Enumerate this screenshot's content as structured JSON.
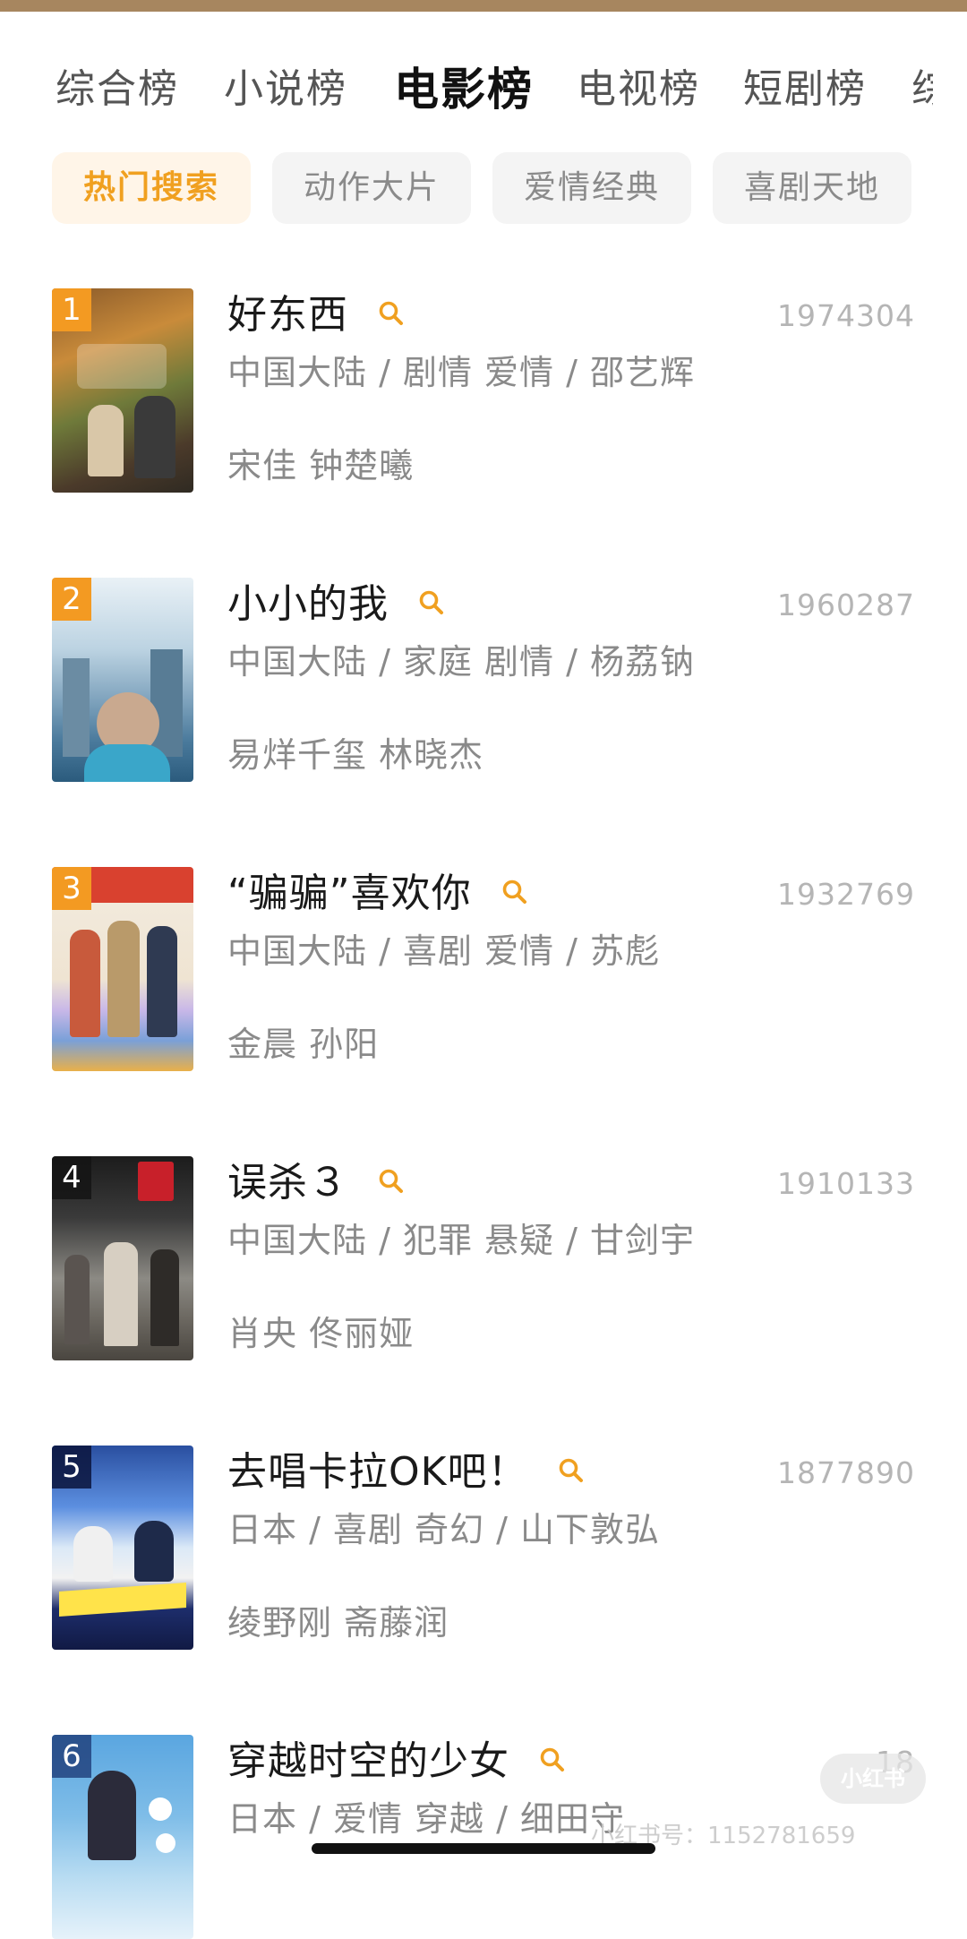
{
  "category_tabs": [
    {
      "label": "综合榜",
      "active": false
    },
    {
      "label": "小说榜",
      "active": false
    },
    {
      "label": "电影榜",
      "active": true
    },
    {
      "label": "电视榜",
      "active": false
    },
    {
      "label": "短剧榜",
      "active": false
    },
    {
      "label": "综",
      "active": false
    }
  ],
  "filter_chips": [
    {
      "label": "热门搜索",
      "active": true
    },
    {
      "label": "动作大片",
      "active": false
    },
    {
      "label": "爱情经典",
      "active": false
    },
    {
      "label": "喜剧天地",
      "active": false
    }
  ],
  "colors": {
    "accent": "#f39a22",
    "chip_active_text": "#f0a020",
    "text_secondary": "#8a8a8a"
  },
  "items": [
    {
      "rank": "1",
      "title": "好东西",
      "hot": "1974304",
      "meta": "中国大陆 / 剧情 爱情 / 邵艺辉",
      "cast": "宋佳 钟楚曦"
    },
    {
      "rank": "2",
      "title": "小小的我",
      "hot": "1960287",
      "meta": "中国大陆 / 家庭 剧情 / 杨荔钠",
      "cast": "易烊千玺 林晓杰"
    },
    {
      "rank": "3",
      "title": "“骗骗”喜欢你",
      "hot": "1932769",
      "meta": "中国大陆 / 喜剧 爱情 / 苏彪",
      "cast": "金晨 孙阳"
    },
    {
      "rank": "4",
      "title": "误杀３",
      "hot": "1910133",
      "meta": "中国大陆 / 犯罪 悬疑 / 甘剑宇",
      "cast": "肖央 佟丽娅"
    },
    {
      "rank": "5",
      "title": "去唱卡拉OK吧！",
      "hot": "1877890",
      "meta": "日本 / 喜剧 奇幻 / 山下敦弘",
      "cast": "绫野刚 斋藤润"
    },
    {
      "rank": "6",
      "title": "穿越时空的少女",
      "hot": "18",
      "meta": "日本 / 爱情 穿越 / 细田守",
      "cast": ""
    }
  ],
  "watermark": {
    "badge": "小红书",
    "id": "小红书号：1152781659"
  }
}
